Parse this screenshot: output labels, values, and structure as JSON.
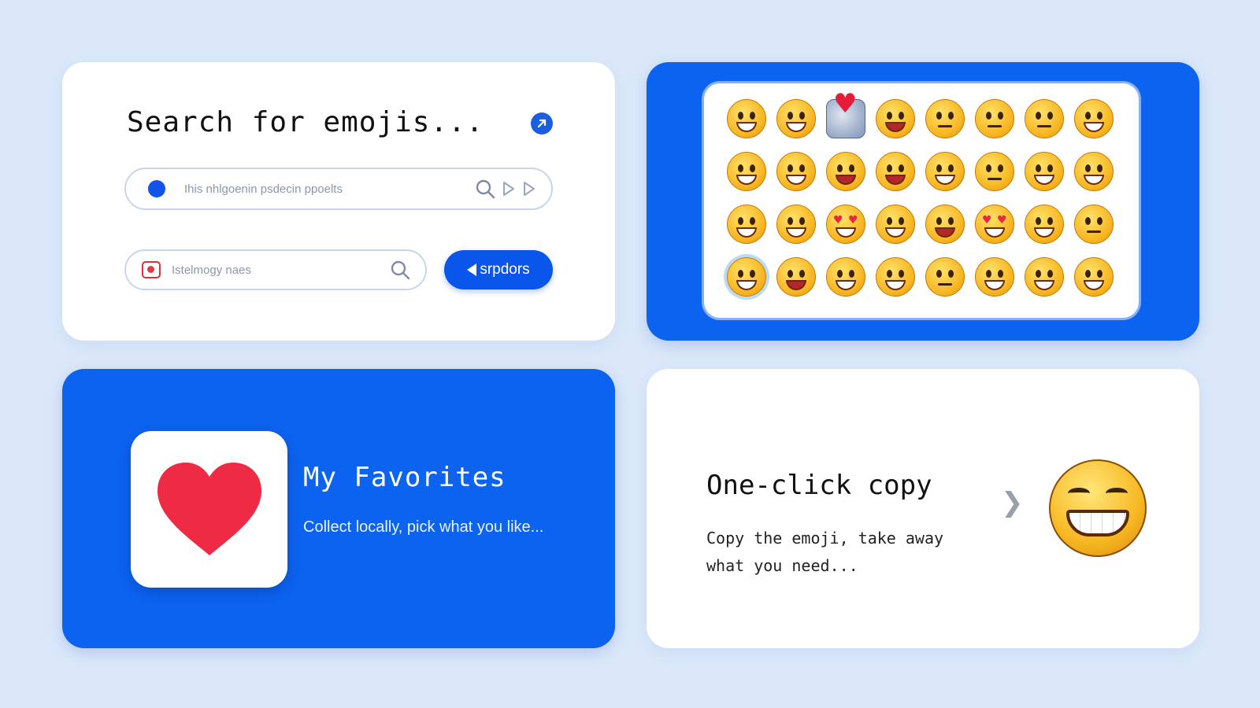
{
  "colors": {
    "background": "#dbe8fa",
    "accent": "#0c63f0",
    "heart": "#ee2a44"
  },
  "search_card": {
    "title": "Search for emojis...",
    "corner_icon": "arrow-up-right-icon",
    "field_1": {
      "placeholder": "Ihis nhlgoenin psdecin ppoelts",
      "icons": [
        "search-icon",
        "play-outline-icon",
        "play-outline-icon"
      ]
    },
    "field_2": {
      "placeholder": "Istelmogy naes",
      "icons": [
        "sticker-icon",
        "search-icon"
      ]
    },
    "action_button": {
      "label": "srpdors",
      "icon": "back-triangle-icon"
    }
  },
  "grid_card": {
    "emojis": [
      "grinning-open",
      "grinning-teeth",
      "robot-heart",
      "tongue",
      "neutral",
      "neutral",
      "neutral",
      "grinning-teeth",
      "laughing",
      "wink-tongue",
      "happy-open",
      "surprised",
      "kiss-wink",
      "smirk",
      "squint-grin",
      "squint-grin",
      "tongue-wink",
      "grin-sweat",
      "heart-eyes",
      "laugh-open",
      "shocked",
      "heart-eyes",
      "laugh-open",
      "neutral",
      "grin-ring",
      "kiss",
      "smile",
      "laugh-open",
      "neutral",
      "laugh-open",
      "squint-grin",
      "laugh-open"
    ]
  },
  "favorites_card": {
    "title": "My Favorites",
    "subtitle": "Collect locally, pick what you like...",
    "icon": "heart-icon"
  },
  "copy_card": {
    "title": "One-click copy",
    "subtitle": "Copy the emoji, take away what you need...",
    "chevron": "❯",
    "emoji": "beaming-face-icon"
  }
}
